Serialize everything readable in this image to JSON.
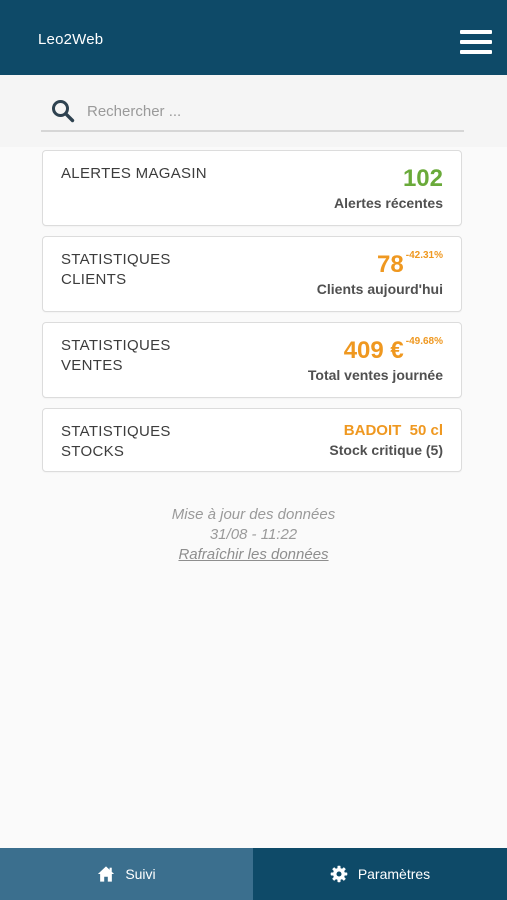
{
  "header": {
    "title": "Leo2Web",
    "menu_icon": "hamburger-menu-icon",
    "background": "#0e4a68"
  },
  "search": {
    "placeholder": "Rechercher ...",
    "value": "",
    "icon": "search-icon"
  },
  "cards": [
    {
      "title": "ALERTES MAGASIN",
      "value": "102",
      "delta": "",
      "subtitle": "Alertes récentes",
      "value_color": "#6aaa3a"
    },
    {
      "title": "STATISTIQUES\nCLIENTS",
      "value": "78",
      "delta": "-42.31%",
      "subtitle": "Clients aujourd'hui",
      "value_color": "#ef9820"
    },
    {
      "title": "STATISTIQUES\nVENTES",
      "value": "409 €",
      "delta": "-49.68%",
      "subtitle": "Total ventes journée",
      "value_color": "#ef9820"
    },
    {
      "title": "STATISTIQUES\nSTOCKS",
      "value": "BADOIT  50 cl",
      "delta": "",
      "subtitle": "Stock critique (5)",
      "value_color": "#ef9820"
    }
  ],
  "update": {
    "label": "Mise à jour des données",
    "datetime": "31/08 - 11:22",
    "refresh_link": "Rafraîchir les données"
  },
  "bottom_nav": [
    {
      "label": "Suivi",
      "icon": "home-icon",
      "active": true
    },
    {
      "label": "Paramètres",
      "icon": "gear-icon",
      "active": false
    }
  ],
  "colors": {
    "accent_green": "#6aaa3a",
    "accent_orange": "#ef9820",
    "nav_active": "#3b6f8e",
    "nav_inactive": "#0e4a68"
  }
}
